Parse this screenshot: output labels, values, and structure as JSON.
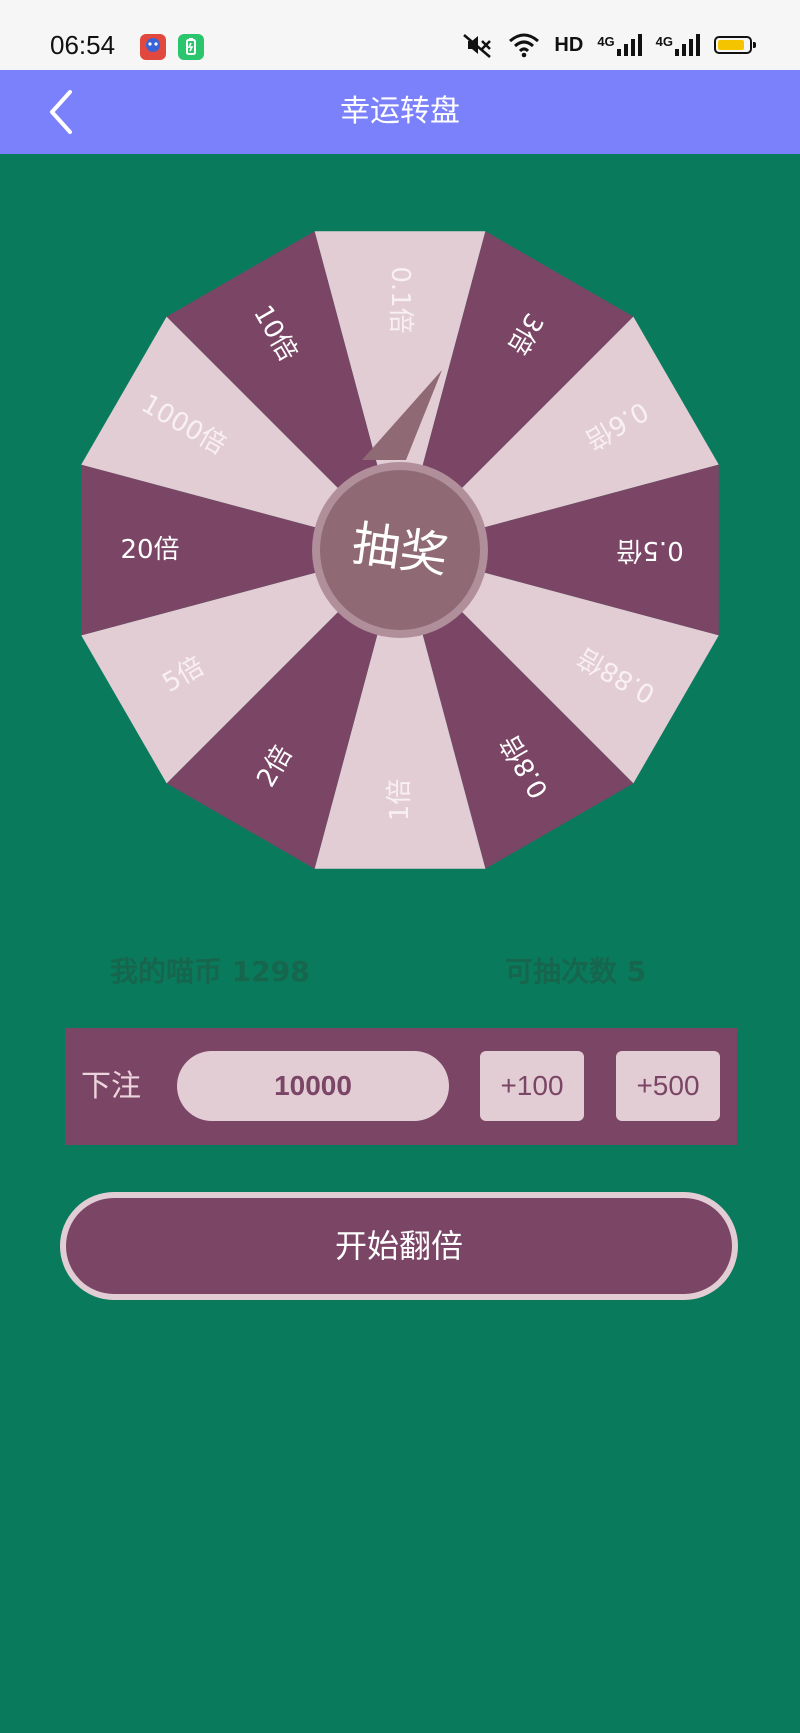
{
  "status_bar": {
    "time": "06:54",
    "network_label": "HD",
    "signal_label_1": "4G",
    "signal_label_2": "4G",
    "battery_level": 0.85,
    "battery_color": "#f5c400",
    "icons": [
      "baidu-app-icon",
      "battery-saver-app-icon",
      "mute-icon",
      "wifi-icon",
      "signal-icon",
      "battery-icon"
    ]
  },
  "header": {
    "title": "幸运转盘",
    "back_icon": "chevron-left-icon",
    "background": "#7b80fb"
  },
  "wheel": {
    "center_label": "抽奖",
    "colors": {
      "dark": "#7b4565",
      "light": "#e3cdd5",
      "hub": "#8f6a75",
      "hub_ring": "#b08f9b"
    },
    "segments": [
      {
        "label": "0.1倍",
        "shade": "light"
      },
      {
        "label": "3倍",
        "shade": "dark"
      },
      {
        "label": "0.6倍",
        "shade": "light"
      },
      {
        "label": "0.5倍",
        "shade": "dark"
      },
      {
        "label": "0.88倍",
        "shade": "light"
      },
      {
        "label": "0.8倍",
        "shade": "dark"
      },
      {
        "label": "1倍",
        "shade": "light"
      },
      {
        "label": "2倍",
        "shade": "dark"
      },
      {
        "label": "5倍",
        "shade": "light"
      },
      {
        "label": "20倍",
        "shade": "dark"
      },
      {
        "label": "1000倍",
        "shade": "light"
      },
      {
        "label": "10倍",
        "shade": "dark"
      }
    ]
  },
  "info": {
    "coins_text": "我的喵币 1298",
    "draws_text": "可抽次数 5"
  },
  "bet": {
    "label": "下注",
    "value": "10000",
    "plus_100": "+100",
    "plus_500": "+500"
  },
  "start_button": {
    "label": "开始翻倍"
  },
  "theme": {
    "background": "#0a7a5c"
  }
}
